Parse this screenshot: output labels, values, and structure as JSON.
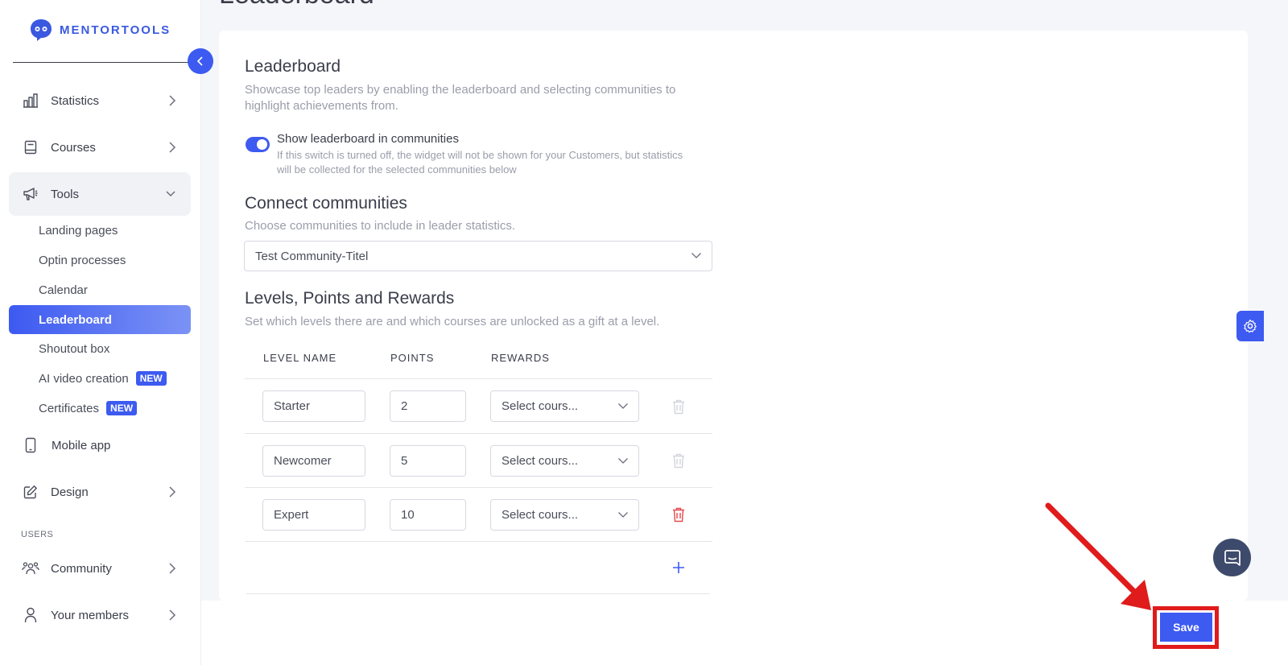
{
  "brand": {
    "name": "MENTORTOOLS",
    "accent": "#3d5af1"
  },
  "page": {
    "title": "Leaderboard"
  },
  "sidebar": {
    "items": [
      {
        "label": "Statistics",
        "icon": "bar-chart-icon"
      },
      {
        "label": "Courses",
        "icon": "book-icon"
      },
      {
        "label": "Tools",
        "icon": "megaphone-icon"
      }
    ],
    "tools_sub": [
      {
        "label": "Landing pages"
      },
      {
        "label": "Optin processes"
      },
      {
        "label": "Calendar"
      },
      {
        "label": "Leaderboard"
      },
      {
        "label": "Shoutout box"
      },
      {
        "label": "AI video creation",
        "badge": "NEW"
      },
      {
        "label": "Certificates",
        "badge": "NEW"
      }
    ],
    "more_items": [
      {
        "label": "Mobile app",
        "icon": "phone-icon"
      },
      {
        "label": "Design",
        "icon": "pencil-icon"
      }
    ],
    "users_section": "USERS",
    "user_items": [
      {
        "label": "Community",
        "icon": "people-icon"
      },
      {
        "label": "Your members",
        "icon": "user-icon"
      }
    ]
  },
  "leaderboard": {
    "heading": "Leaderboard",
    "description": "Showcase top leaders by enabling the leaderboard and selecting communities to highlight achievements from.",
    "toggle_label": "Show leaderboard in communities",
    "toggle_help": "If this switch is turned off, the widget will not be shown for your Customers, but statistics will be collected for the selected communities below",
    "toggle_on": true
  },
  "communities": {
    "heading": "Connect communities",
    "description": "Choose communities to include in leader statistics.",
    "selected": "Test Community-Titel"
  },
  "levels": {
    "heading": "Levels, Points and Rewards",
    "description": "Set which levels there are and which courses are unlocked as a gift at a level.",
    "columns": [
      "LEVEL NAME",
      "POINTS",
      "REWARDS"
    ],
    "rows": [
      {
        "name": "Starter",
        "points": "2",
        "reward": "Select cours..."
      },
      {
        "name": "Newcomer",
        "points": "5",
        "reward": "Select cours..."
      },
      {
        "name": "Expert",
        "points": "10",
        "reward": "Select cours..."
      }
    ]
  },
  "footer": {
    "save_label": "Save"
  }
}
